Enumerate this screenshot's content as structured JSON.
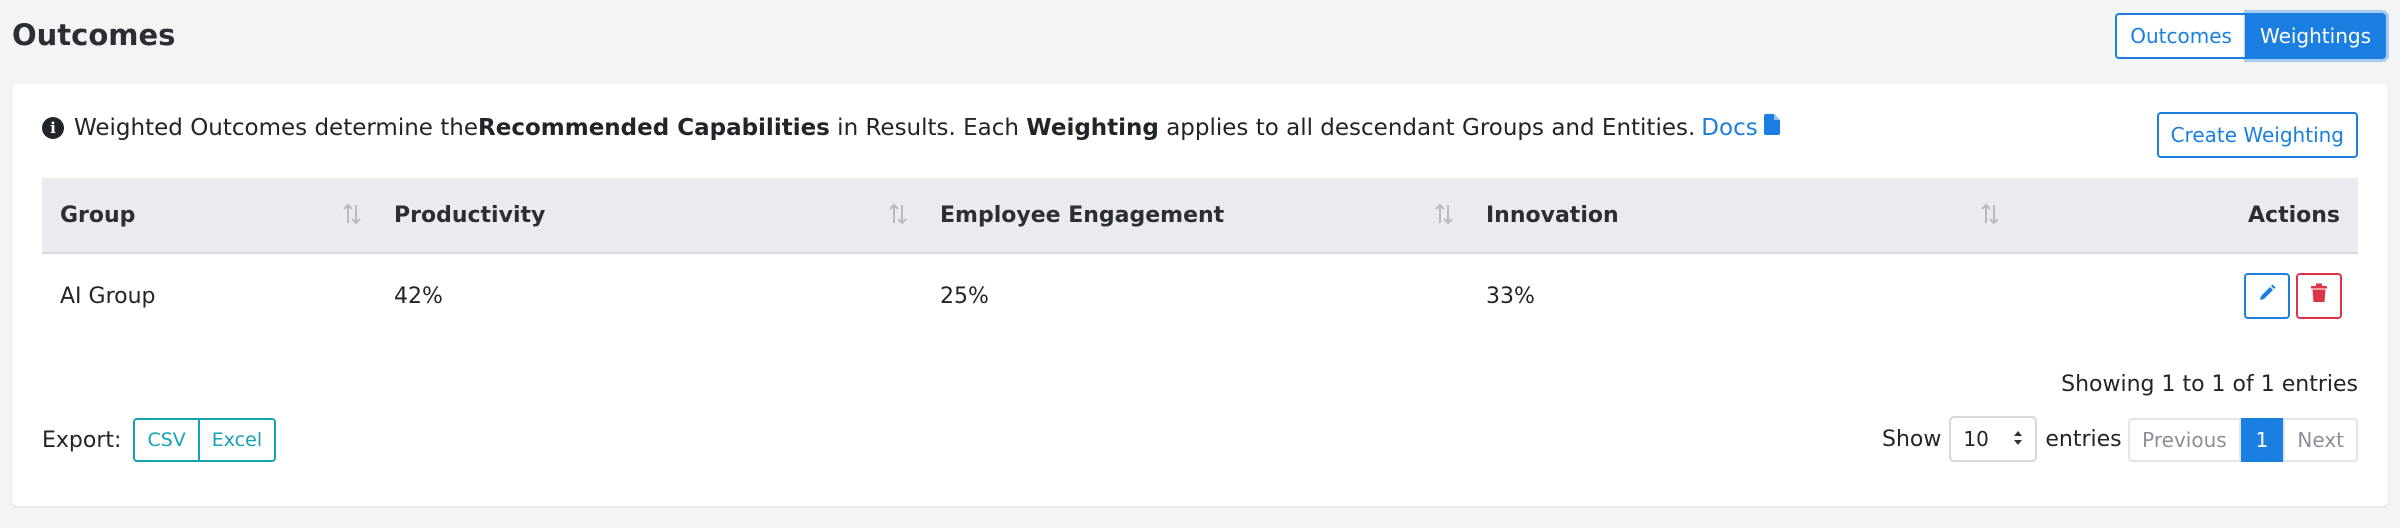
{
  "page": {
    "title": "Outcomes",
    "toggle": {
      "outcomes_label": "Outcomes",
      "weightings_label": "Weightings",
      "active": "Weightings"
    }
  },
  "info": {
    "prefix": "Weighted Outcomes determine the ",
    "bold1": "Recommended Capabilities",
    "middle": " in Results. Each ",
    "bold2": "Weighting",
    "suffix": " applies to all descendant Groups and Entities.",
    "docs_label": "Docs",
    "icon": "info-circle-icon"
  },
  "actions": {
    "create_label": "Create Weighting"
  },
  "table": {
    "columns": [
      "Group",
      "Productivity",
      "Employee Engagement",
      "Innovation",
      "Actions"
    ],
    "rows": [
      [
        "AI Group",
        "42%",
        "25%",
        "33%"
      ]
    ]
  },
  "footer": {
    "showing": "Showing 1 to 1 of 1 entries",
    "export_label": "Export:",
    "csv_label": "CSV",
    "excel_label": "Excel",
    "show_label": "Show",
    "page_length": "10",
    "entries_label": "entries",
    "previous_label": "Previous",
    "current_page": "1",
    "next_label": "Next"
  },
  "colors": {
    "primary": "#1a7fe0",
    "danger": "#dc3545",
    "info": "#17a2b8"
  }
}
